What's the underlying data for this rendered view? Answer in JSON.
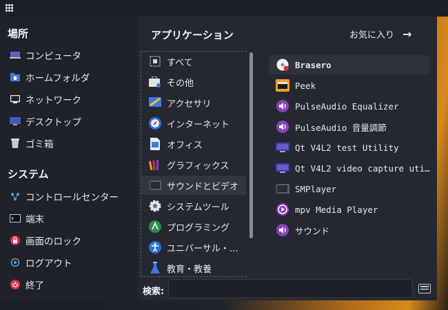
{
  "sidebar": {
    "places_heading": "場所",
    "places": [
      {
        "label": "コンピュータ",
        "icon": "computer-icon"
      },
      {
        "label": "ホームフォルダ",
        "icon": "home-folder-icon"
      },
      {
        "label": "ネットワーク",
        "icon": "network-icon"
      },
      {
        "label": "デスクトップ",
        "icon": "desktop-icon"
      },
      {
        "label": "ゴミ箱",
        "icon": "trash-icon"
      }
    ],
    "system_heading": "システム",
    "system": [
      {
        "label": "コントロールセンター",
        "icon": "control-center-icon"
      },
      {
        "label": "端末",
        "icon": "terminal-icon"
      },
      {
        "label": "画面のロック",
        "icon": "lock-icon"
      },
      {
        "label": "ログアウト",
        "icon": "logout-icon"
      },
      {
        "label": "終了",
        "icon": "power-icon"
      }
    ]
  },
  "main": {
    "heading": "アプリケーション",
    "favorites_label": "お気に入り",
    "favorites_arrow": "→",
    "categories": [
      {
        "label": "すべて",
        "icon": "all-apps-icon"
      },
      {
        "label": "その他",
        "icon": "other-icon"
      },
      {
        "label": "アクセサリ",
        "icon": "accessories-icon"
      },
      {
        "label": "インターネット",
        "icon": "internet-icon"
      },
      {
        "label": "オフィス",
        "icon": "office-icon"
      },
      {
        "label": "グラフィックス",
        "icon": "graphics-icon"
      },
      {
        "label": "サウンドとビデオ",
        "icon": "sound-video-icon",
        "selected": true
      },
      {
        "label": "システムツール",
        "icon": "system-tools-icon"
      },
      {
        "label": "プログラミング",
        "icon": "programming-icon"
      },
      {
        "label": "ユニバーサル・…",
        "icon": "accessibility-icon"
      },
      {
        "label": "教育・教養",
        "icon": "education-icon"
      }
    ],
    "apps": [
      {
        "label": "Brasero",
        "icon": "brasero-icon",
        "selected": true
      },
      {
        "label": "Peek",
        "icon": "peek-icon"
      },
      {
        "label": "PulseAudio Equalizer",
        "icon": "pulseaudio-icon"
      },
      {
        "label": "PulseAudio 音量調節",
        "icon": "pulseaudio-icon"
      },
      {
        "label": "Qt V4L2 test Utility",
        "icon": "qv4l2-icon"
      },
      {
        "label": "Qt V4L2 video capture uti…",
        "icon": "qvidcap-icon"
      },
      {
        "label": "SMPlayer",
        "icon": "smplayer-icon"
      },
      {
        "label": "mpv Media Player",
        "icon": "mpv-icon"
      },
      {
        "label": "サウンド",
        "icon": "sound-icon"
      }
    ]
  },
  "search": {
    "label": "検索:",
    "value": "",
    "placeholder": ""
  },
  "colors": {
    "menu_bg": "#252830",
    "sidebar_bg": "#1f2229",
    "selected_bg": "#33363f",
    "purple_accent": "#8a3fb8",
    "desktop_orange": "#d88b1c"
  }
}
